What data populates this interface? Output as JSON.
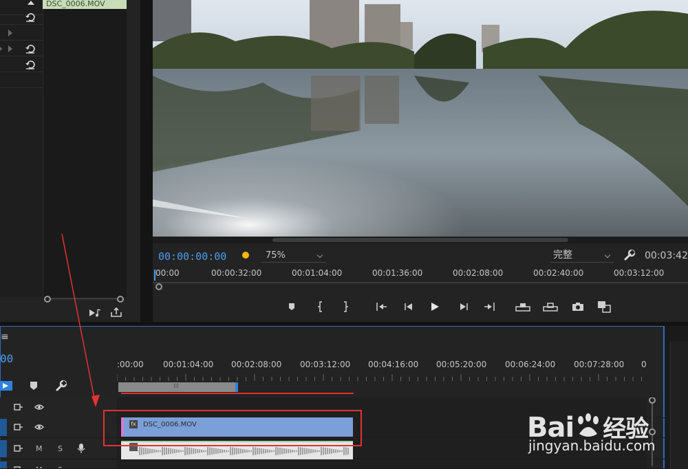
{
  "effect_controls": {
    "clip_label": "DSC_0006.MOV",
    "reset_icons": [
      "reset-icon",
      "reset-icon",
      "reset-icon"
    ]
  },
  "monitor": {
    "playhead_timecode": "00:00:00:00",
    "zoom_level": "75%",
    "resolution": "完整",
    "duration_timecode": "00:03:42",
    "ruler_ticks": [
      "00:00",
      "00:00:32:00",
      "00:01:04:00",
      "00:01:36:00",
      "00:02:08:00",
      "00:02:40:00",
      "00:03:12:00"
    ],
    "transport_icons": [
      "marker-icon",
      "mark-in-icon",
      "mark-out-icon",
      "go-to-in-icon",
      "step-back-icon",
      "play-icon",
      "step-forward-icon",
      "go-to-out-icon",
      "lift-icon",
      "extract-icon",
      "export-frame-icon",
      "compare-icon"
    ]
  },
  "timeline": {
    "menu_glyph": "≡",
    "timecode": "00",
    "ruler_ticks": [
      ":00:00",
      "00:01:04:00",
      "00:02:08:00",
      "00:03:12:00",
      "00:04:16:00",
      "00:05:20:00",
      "00:06:24:00",
      "00:07:28:00",
      "0"
    ],
    "work_area_label": "III",
    "tracks": [
      {
        "type": "video",
        "controls": [
          "sync-icon",
          "eye-icon"
        ]
      },
      {
        "type": "video",
        "controls": [
          "sync-icon",
          "eye-icon"
        ]
      },
      {
        "type": "audio",
        "mute": "M",
        "solo": "S"
      },
      {
        "type": "audio",
        "mute": "M",
        "solo": "S"
      }
    ],
    "video_clip": {
      "label": "DSC_0006.MOV",
      "fx_badge": "fx",
      "label_color": "#7b9fd8"
    },
    "audio_clip": {
      "fx_badge": "fx"
    }
  },
  "watermark": {
    "brand": "Bai",
    "brand_cn": "经验",
    "url": "jingyan.baidu.com"
  },
  "colors": {
    "accent_blue": "#4a9ff0",
    "annotation_red": "#e23333",
    "playhead_yellow": "#f5b800"
  }
}
